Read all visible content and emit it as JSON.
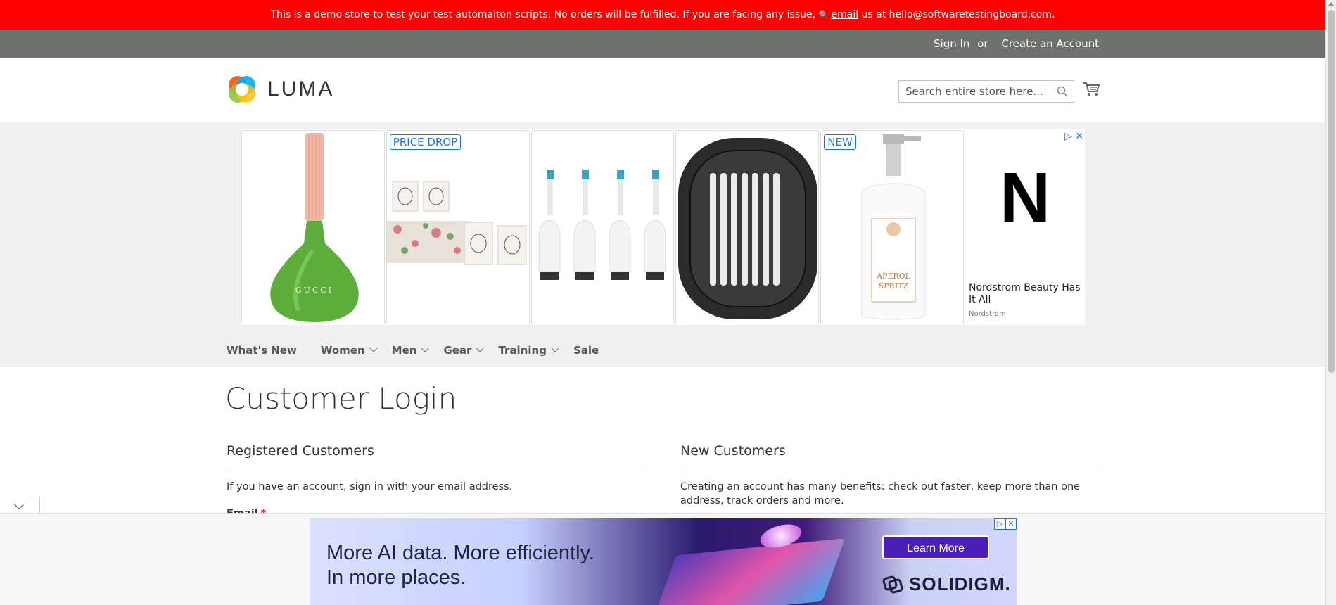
{
  "demo_notice": {
    "text_before": "This is a demo store to test your test automaiton scripts. No orders will be fulfilled. If you are facing any issue,",
    "email_link": "email",
    "text_after": "us at hello@softwaretestingboard.com."
  },
  "panel": {
    "sign_in": "Sign In",
    "or": "or",
    "create_account": "Create an Account"
  },
  "logo": {
    "text": "LUMA"
  },
  "search": {
    "placeholder": "Search entire store here...",
    "icon": "search-icon"
  },
  "cart": {
    "icon": "cart-icon"
  },
  "top_ad": {
    "badges": [
      "PRICE DROP",
      "NEW"
    ],
    "side_logo": "N",
    "headline": "Nordstrom Beauty Has It All",
    "advertiser": "Nordstrom",
    "products": [
      "nail-polish-bottle",
      "candle-set",
      "toothbrush-heads",
      "diffuser-case",
      "lotion-bottle"
    ]
  },
  "nav": {
    "items": [
      {
        "label": "What's New",
        "has_dropdown": false
      },
      {
        "label": "Women",
        "has_dropdown": true
      },
      {
        "label": "Men",
        "has_dropdown": true
      },
      {
        "label": "Gear",
        "has_dropdown": true
      },
      {
        "label": "Training",
        "has_dropdown": true
      },
      {
        "label": "Sale",
        "has_dropdown": false
      }
    ]
  },
  "page": {
    "title": "Customer Login"
  },
  "registered": {
    "title": "Registered Customers",
    "intro": "If you have an account, sign in with your email address.",
    "email_label": "Email",
    "required_mark": "*"
  },
  "new_customers": {
    "title": "New Customers",
    "intro": "Creating an account has many benefits: check out faster, keep more than one address, track orders and more."
  },
  "bottom_ad": {
    "headline_line1": "More AI data. More efficiently.",
    "headline_line2": "In more places.",
    "cta": "Learn More",
    "brand": "SOLIDIGM."
  },
  "colors": {
    "demo_bar": "#ff0000",
    "panel_bar": "#6e716e",
    "nav_bg": "#f0f0f0",
    "required": "#e02b27",
    "ad_blue": "#1a73e8"
  }
}
